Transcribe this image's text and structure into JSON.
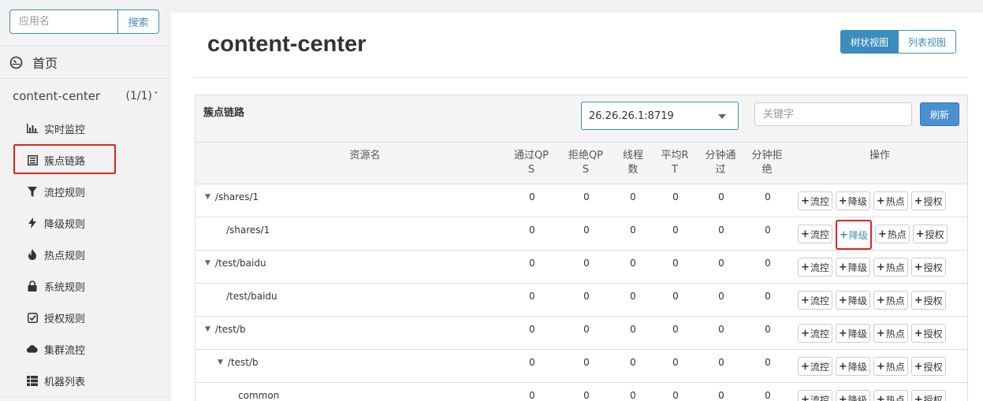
{
  "sidebar": {
    "search_placeholder": "应用名",
    "search_button": "搜索",
    "home_label": "首页",
    "app": {
      "name": "content-center",
      "count": "(1/1)",
      "chevron": "˅"
    },
    "menu": [
      {
        "label": "实时监控",
        "icon": "bar-chart-icon"
      },
      {
        "label": "簇点链路",
        "icon": "list-icon",
        "active": true
      },
      {
        "label": "流控规则",
        "icon": "filter-icon"
      },
      {
        "label": "降级规则",
        "icon": "bolt-icon"
      },
      {
        "label": "热点规则",
        "icon": "fire-icon"
      },
      {
        "label": "系统规则",
        "icon": "lock-icon"
      },
      {
        "label": "授权规则",
        "icon": "check-square-icon"
      },
      {
        "label": "集群流控",
        "icon": "cloud-icon"
      },
      {
        "label": "机器列表",
        "icon": "th-list-icon"
      }
    ]
  },
  "main": {
    "title": "content-center",
    "view_toggle": {
      "tree": "树状视图",
      "list": "列表视图"
    },
    "panel": {
      "title": "簇点链路",
      "machine": "26.26.26.1:8719",
      "keyword_placeholder": "关键字",
      "refresh": "刷新"
    },
    "table": {
      "headers": {
        "resource": "资源名",
        "pass_qps": [
          "通过QP",
          "S"
        ],
        "block_qps": [
          "拒绝QP",
          "S"
        ],
        "threads": [
          "线程",
          "数"
        ],
        "avg_rt": [
          "平均R",
          "T"
        ],
        "minute_pass": [
          "分钟通",
          "过"
        ],
        "minute_block": [
          "分钟拒",
          "绝"
        ],
        "ops": "操作"
      },
      "op_labels": {
        "flow": "流控",
        "degrade": "降级",
        "hot": "热点",
        "auth": "授权",
        "plus": "+"
      },
      "rows": [
        {
          "name": "/shares/1",
          "level": 0,
          "expanded": true,
          "values": [
            "0",
            "0",
            "0",
            "0",
            "0",
            "0"
          ]
        },
        {
          "name": "/shares/1",
          "level": 1,
          "expanded": false,
          "values": [
            "0",
            "0",
            "0",
            "0",
            "0",
            "0"
          ],
          "highlight_degrade": true
        },
        {
          "name": "/test/baidu",
          "level": 0,
          "expanded": true,
          "values": [
            "0",
            "0",
            "0",
            "0",
            "0",
            "0"
          ]
        },
        {
          "name": "/test/baidu",
          "level": 1,
          "expanded": false,
          "values": [
            "0",
            "0",
            "0",
            "0",
            "0",
            "0"
          ]
        },
        {
          "name": "/test/b",
          "level": 0,
          "expanded": true,
          "values": [
            "0",
            "0",
            "0",
            "0",
            "0",
            "0"
          ]
        },
        {
          "name": "/test/b",
          "level": 1,
          "expanded": true,
          "values": [
            "0",
            "0",
            "0",
            "0",
            "0",
            "0"
          ]
        },
        {
          "name": "common",
          "level": 2,
          "expanded": false,
          "values": [
            "0",
            "0",
            "0",
            "0",
            "0",
            "0"
          ]
        }
      ]
    }
  },
  "colors": {
    "accent": "#3c8dbc",
    "highlight": "#e1251b",
    "refresh": "#4a8fd2"
  }
}
